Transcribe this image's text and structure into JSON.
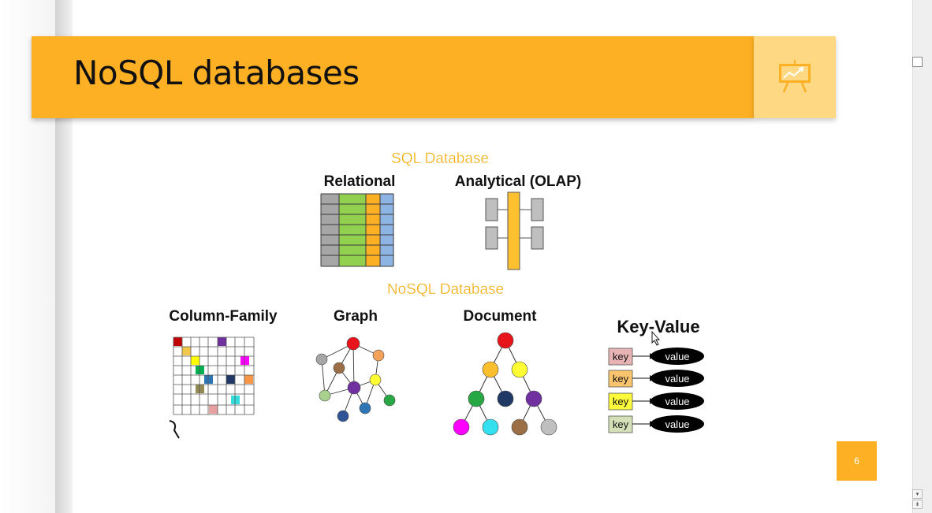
{
  "slide": {
    "title": "NoSQL databases",
    "page_number": "6",
    "icon": "presentation-board-chart-icon"
  },
  "diagram": {
    "sql_heading": "SQL Database",
    "nosql_heading": "NoSQL Database",
    "sql_types": [
      "Relational",
      "Analytical (OLAP)"
    ],
    "nosql_types": [
      "Column-Family",
      "Graph",
      "Document",
      "Key-Value"
    ],
    "key_value_rows": [
      {
        "key": "key",
        "value": "value",
        "key_color": "#e7b3b3"
      },
      {
        "key": "key",
        "value": "value",
        "key_color": "#fbc46e"
      },
      {
        "key": "key",
        "value": "value",
        "key_color": "#fbfb3c"
      },
      {
        "key": "key",
        "value": "value",
        "key_color": "#d5dfb8"
      }
    ]
  },
  "colors": {
    "accent": "#fdb023",
    "accent_light": "#fed882",
    "relational_green": "#92d050",
    "relational_orange": "#fdb023",
    "relational_blue": "#8eb4e3"
  },
  "scrollbar": {
    "up_glyph": "▾",
    "down_glyph": "⇟"
  }
}
